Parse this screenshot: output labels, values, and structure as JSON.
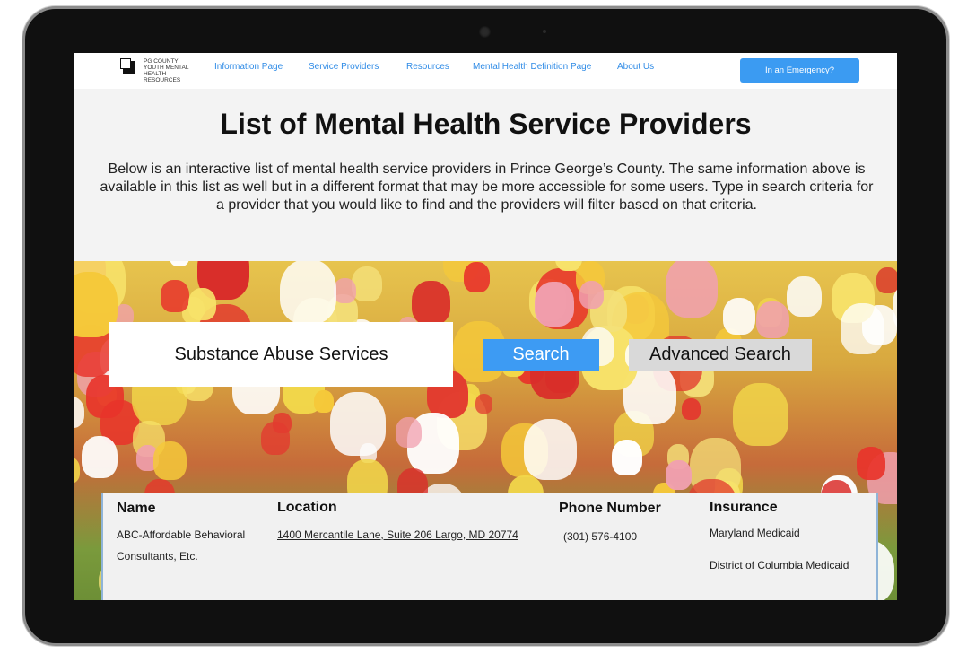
{
  "nav": {
    "logo_lines": [
      "PG COUNTY",
      "YOUTH MENTAL",
      "HEALTH",
      "RESOURCES"
    ],
    "links": [
      "Information Page",
      "Service Providers",
      "Resources",
      "Mental Health Definition Page",
      "About Us"
    ],
    "emergency_label": "In an Emergency?"
  },
  "page": {
    "title": "List of Mental Health Service Providers",
    "description": "Below is an interactive list of mental health service providers in Prince George’s County. The same information above is available in this list as well but in a different format that may be more accessible for some users. Type in search criteria for a provider that you would like to find and the providers will filter based on that criteria."
  },
  "search": {
    "query": "Substance Abuse Services",
    "search_label": "Search",
    "advanced_label": "Advanced Search"
  },
  "table": {
    "headers": [
      "Name",
      "Location",
      "Phone Number",
      "Insurance"
    ],
    "rows": [
      {
        "name": "ABC-Affordable Behavioral Consultants, Etc.",
        "location": "1400 Mercantile Lane, Suite 206 Largo, MD 20774",
        "phone": "(301) 576-4100",
        "insurance": [
          "Maryland Medicaid",
          "District of Columbia Medicaid"
        ]
      }
    ]
  }
}
